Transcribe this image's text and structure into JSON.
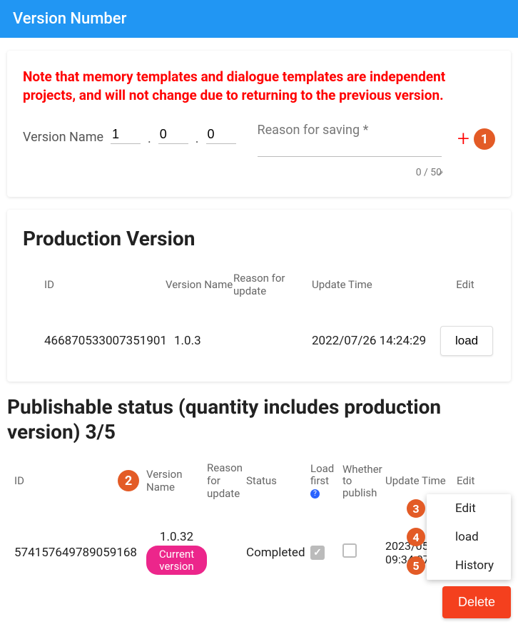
{
  "header": {
    "title": "Version Number"
  },
  "note": "Note that memory templates and dialogue templates are independent projects, and will not change due to returning to the previous version.",
  "form": {
    "version_label": "Version Name",
    "v_major": "1",
    "v_minor": "0",
    "v_patch": "0",
    "reason_label": "Reason for saving *",
    "reason_value": "",
    "counter": "0 / 50",
    "plus_glyph": "+",
    "badge1": "1"
  },
  "production": {
    "title": "Production Version",
    "headers": {
      "id": "ID",
      "vn": "Version Name",
      "reason": "Reason for update",
      "time": "Update Time",
      "edit": "Edit"
    },
    "row": {
      "id": "466870533007351901",
      "vn": "1.0.3",
      "reason": "",
      "time": "2022/07/26 14:24:29",
      "load": "load"
    }
  },
  "publishable": {
    "title": "Publishable status (quantity includes production version) 3/5",
    "badge2": "2",
    "headers": {
      "id": "ID",
      "vn": "Version Name",
      "reason": "Reason for update",
      "status": "Status",
      "loadfirst": "Load first",
      "publish": "Whether to publish",
      "time": "Update Time",
      "edit": "Edit"
    },
    "row": {
      "id": "574157649789059168",
      "vn": "1.0.32",
      "chip": "Current version",
      "reason": "",
      "status": "Completed",
      "loadfirst_checked": true,
      "publish_checked": false,
      "time": "2023/05/ 09:34:07"
    },
    "menu": {
      "edit": {
        "badge": "3",
        "label": "Edit"
      },
      "load": {
        "badge": "4",
        "label": "load"
      },
      "history": {
        "badge": "5",
        "label": "History"
      }
    }
  },
  "delete_label": "Delete"
}
